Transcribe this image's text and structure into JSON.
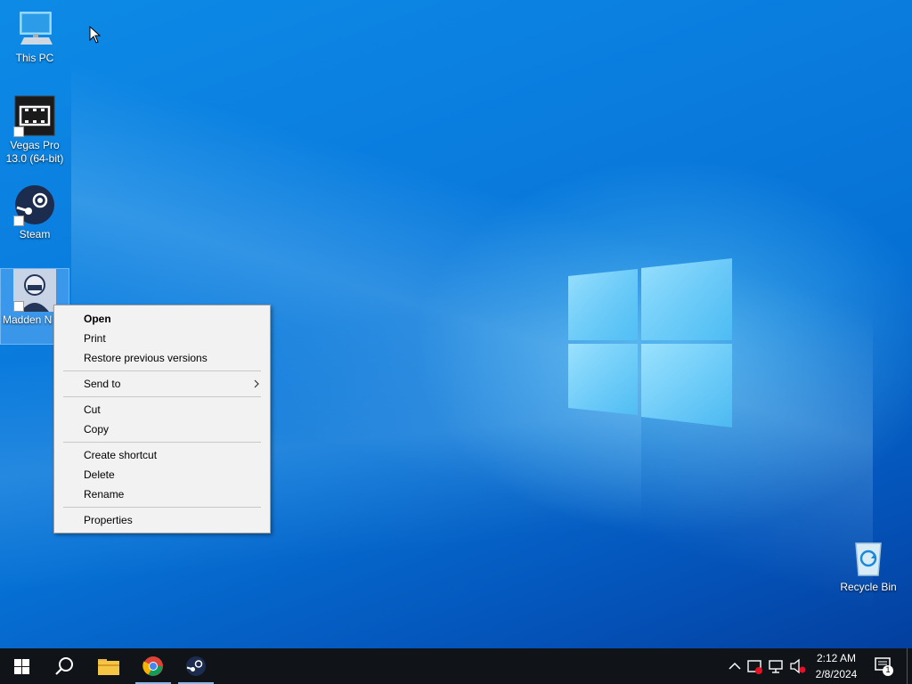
{
  "desktop_icons": [
    {
      "label": "This PC",
      "icon": "this-pc-icon"
    },
    {
      "label": "Vegas Pro 13.0 (64-bit)",
      "icon": "vegas-pro-icon"
    },
    {
      "label": "Steam",
      "icon": "steam-icon"
    },
    {
      "label": "Madden NFL 24",
      "icon": "madden-icon",
      "visible_label": "Madden N 24",
      "selected": true
    },
    {
      "label": "Recycle Bin",
      "icon": "recycle-bin-icon"
    }
  ],
  "context_menu": {
    "items": [
      {
        "label": "Open",
        "bold": true
      },
      {
        "label": "Print"
      },
      {
        "label": "Restore previous versions"
      },
      {
        "label": "Send to",
        "submenu": true
      },
      {
        "label": "Cut"
      },
      {
        "label": "Copy"
      },
      {
        "label": "Create shortcut"
      },
      {
        "label": "Delete"
      },
      {
        "label": "Rename"
      },
      {
        "label": "Properties"
      }
    ]
  },
  "taskbar": {
    "pinned": [
      "start-icon",
      "search-icon",
      "file-explorer-icon",
      "chrome-icon",
      "steam-icon"
    ],
    "tray": [
      "show-hidden-icons-chevron",
      "security-warning-icon",
      "network-icon",
      "volume-muted-icon"
    ],
    "time": "2:12 AM",
    "date": "2/8/2024",
    "notification_count": "1"
  },
  "colors": {
    "accent": "#0a78d6",
    "taskbar": "#101418",
    "menu_bg": "#f2f2f2"
  }
}
